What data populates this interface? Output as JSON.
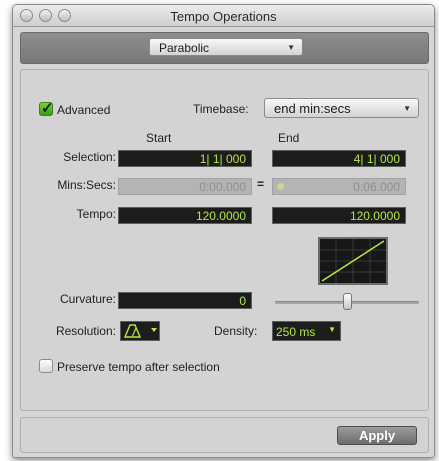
{
  "window": {
    "title": "Tempo Operations"
  },
  "header": {
    "operation_select": "Parabolic"
  },
  "advanced": {
    "label": "Advanced",
    "checked": true
  },
  "timebase": {
    "label": "Timebase:",
    "value": "end min:secs"
  },
  "columns": {
    "start": "Start",
    "end": "End"
  },
  "selection": {
    "label": "Selection:",
    "start": "1| 1| 000",
    "end": "4| 1| 000"
  },
  "mins_secs": {
    "label": "Mins:Secs:",
    "start": "0:00.000",
    "link_symbol": "=",
    "end": "0:06.000"
  },
  "tempo": {
    "label": "Tempo:",
    "start": "120.0000",
    "end": "120.0000"
  },
  "curvature": {
    "label": "Curvature:",
    "value": "0"
  },
  "resolution": {
    "label": "Resolution:"
  },
  "density": {
    "label": "Density:",
    "value": "250 ms"
  },
  "preserve_tempo": {
    "label": "Preserve tempo after selection",
    "checked": false
  },
  "footer": {
    "apply_label": "Apply"
  },
  "colors": {
    "accent_green": "#b6ea3c",
    "field_bg": "#1c1c1c",
    "panel_bg": "#d3d3d3"
  }
}
